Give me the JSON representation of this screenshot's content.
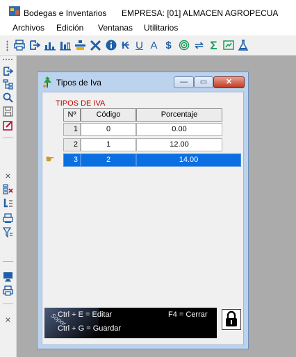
{
  "app": {
    "title": "Bodegas e Inventarios",
    "empresa": "EMPRESA: [01] ALMACEN AGROPECUA"
  },
  "menu": [
    "Archivos",
    "Edición",
    "Ventanas",
    "Utilitarios"
  ],
  "toolbar_icons": [
    "printer-icon",
    "exit-icon",
    "bar-chart-icon",
    "bar-chart-2-icon",
    "transfer-icon",
    "tools-icon",
    "info-icon",
    "k-icon",
    "u-icon",
    "a-icon",
    "dollar-icon",
    "fingerprint-icon",
    "exchange-icon",
    "sigma-icon",
    "report-icon",
    "flask-icon"
  ],
  "sidebar_icons": [
    "exit-icon",
    "list-icon",
    "search-icon",
    "save-icon",
    "edit-icon",
    "delete-icon",
    "remove-row-icon",
    "import-icon",
    "print-preview-icon",
    "filter-icon",
    "monitor-icon",
    "printer-icon",
    "close-icon"
  ],
  "window": {
    "title": "Tipos de  Iva",
    "min_label": "—",
    "max_label": "▭",
    "close_label": "✕"
  },
  "grid": {
    "label": "TIPOS DE IVA",
    "columns": [
      "Nº",
      "Código",
      "Porcentaje"
    ],
    "rows": [
      {
        "n": "1",
        "codigo": "0",
        "porcentaje": "0.00"
      },
      {
        "n": "2",
        "codigo": "1",
        "porcentaje": "12.00"
      },
      {
        "n": "3",
        "codigo": "2",
        "porcentaje": "14.00"
      }
    ],
    "selected_row": 3
  },
  "help": {
    "editar": "Ctrl + E = Editar",
    "cerrar": "F4 = Cerrar",
    "guardar": "Ctrl + G = Guardar",
    "logo_text": "Sopor"
  },
  "colors": {
    "selected_row": "#0a6fe0",
    "grid_label": "#c00000",
    "mdi_background": "#ababab",
    "child_frame": "#bcd3ee"
  }
}
